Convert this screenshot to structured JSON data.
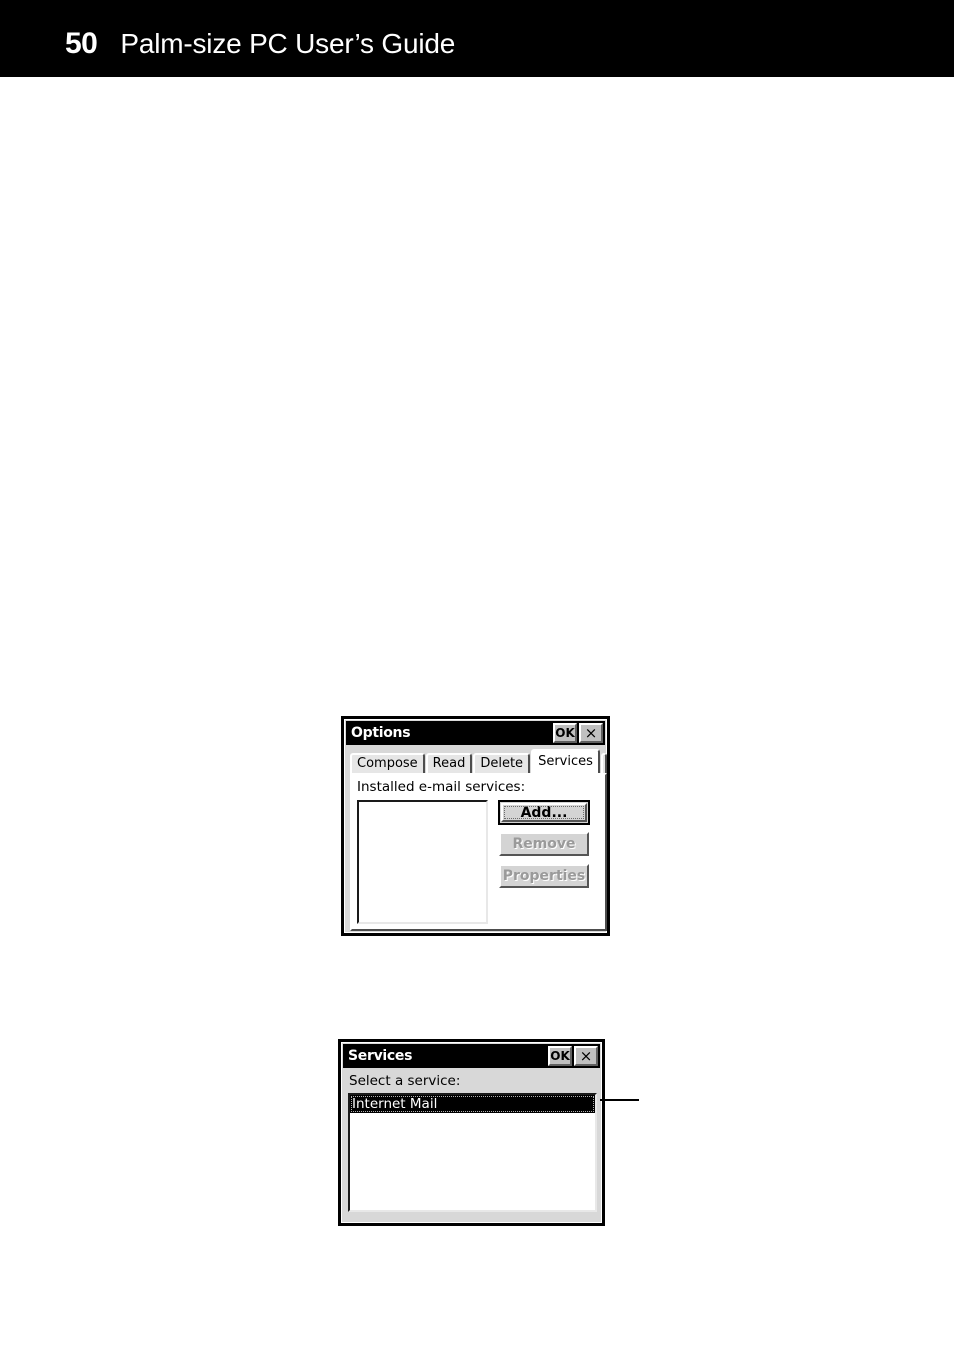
{
  "header": {
    "page_number": "50",
    "title": "Palm-size PC User’s Guide"
  },
  "options_dialog": {
    "title": "Options",
    "ok_label": "OK",
    "close_label": "×",
    "tabs": [
      {
        "label": "Compose",
        "active": false
      },
      {
        "label": "Read",
        "active": false
      },
      {
        "label": "Delete",
        "active": false
      },
      {
        "label": "Services",
        "active": true
      }
    ],
    "services_tab": {
      "list_label": "Installed e-mail services:",
      "list_items": [],
      "buttons": [
        {
          "label": "Add...",
          "state": "default"
        },
        {
          "label": "Remove",
          "state": "disabled"
        },
        {
          "label": "Properties",
          "state": "disabled"
        }
      ]
    }
  },
  "services_dialog": {
    "title": "Services",
    "ok_label": "OK",
    "close_label": "×",
    "list_label": "Select a service:",
    "list_items": [
      {
        "label": "Internet Mail",
        "selected": true
      }
    ]
  }
}
